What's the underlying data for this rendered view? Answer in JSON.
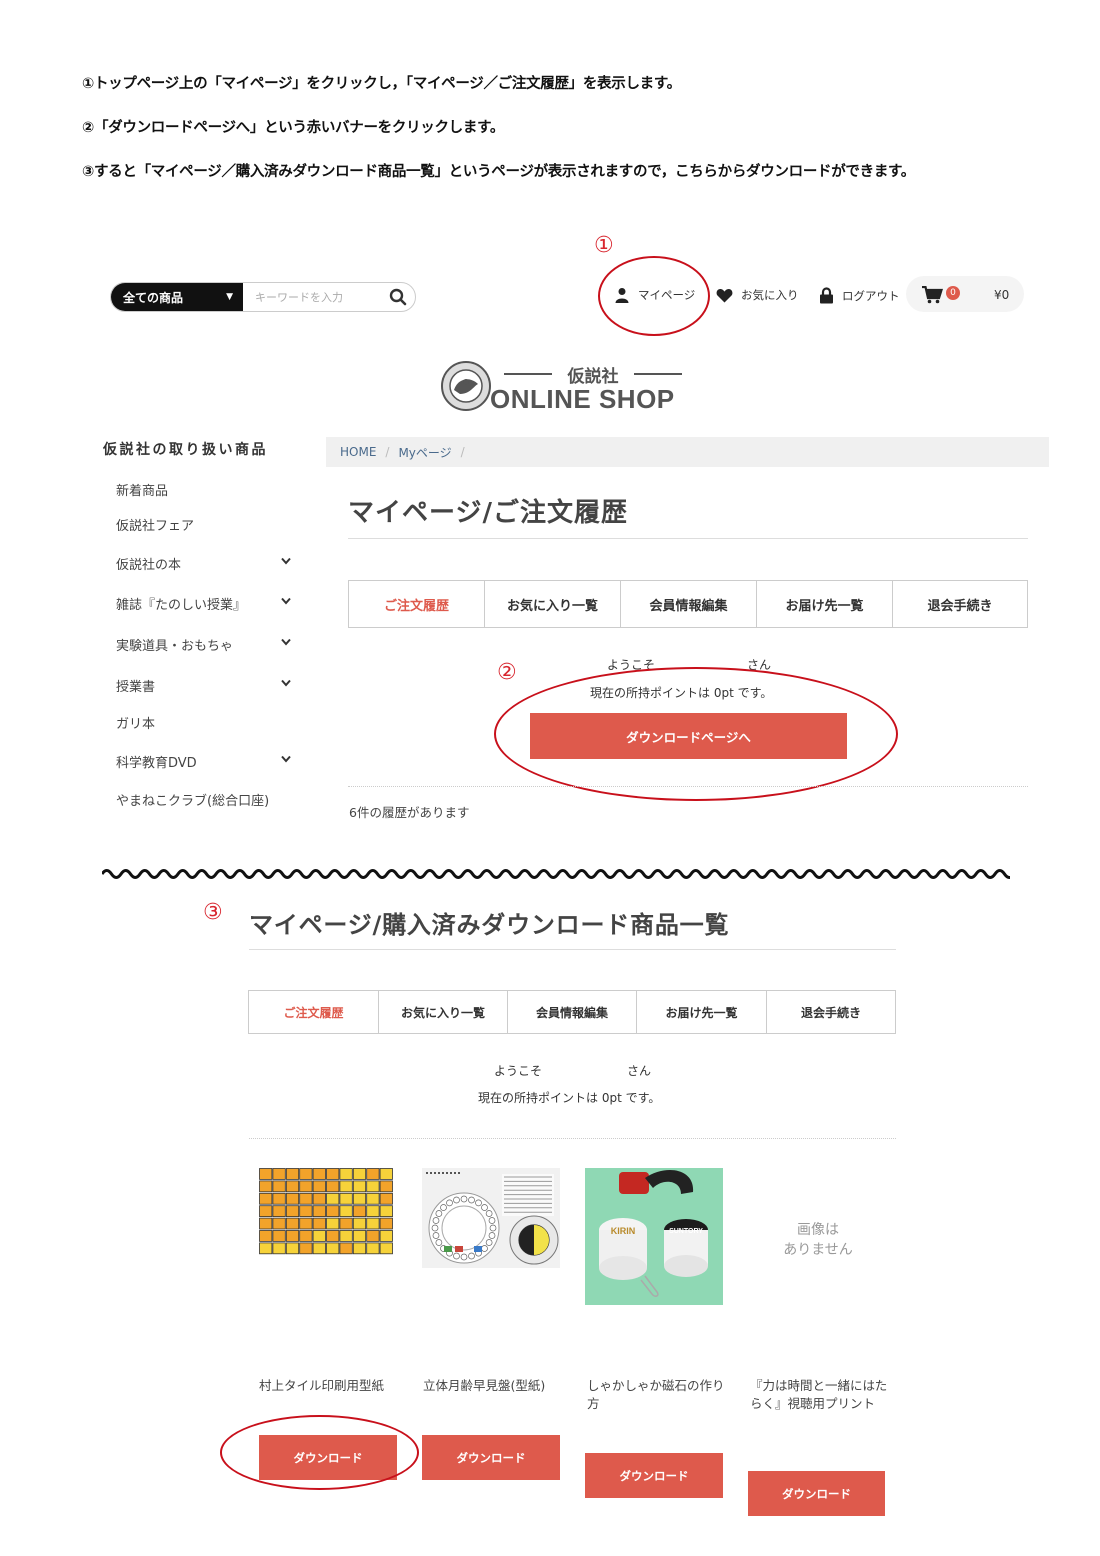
{
  "instructions": [
    "①トップページ上の「マイページ」をクリックし，「マイページ／ご注文履歴」を表示します。",
    "②「ダウンロードページへ」という赤いバナーをクリックします。",
    "③すると「マイページ／購入済みダウンロード商品一覧」というページが表示されますので，こちらからダウンロードができます。"
  ],
  "markers": {
    "one": "①",
    "two": "②",
    "three": "③"
  },
  "header": {
    "category_select": "全ての商品",
    "search_placeholder": "キーワードを入力",
    "mypage": "マイページ",
    "favorites": "お気に入り",
    "logout": "ログアウト",
    "cart_count": "0",
    "cart_total": "¥0"
  },
  "logo": {
    "subtitle": "仮説社",
    "title": "ONLINE SHOP"
  },
  "sidebar": {
    "title": "仮説社の取り扱い商品",
    "items": [
      {
        "label": "新着商品",
        "expandable": false
      },
      {
        "label": "仮説社フェア",
        "expandable": false
      },
      {
        "label": "仮説社の本",
        "expandable": true
      },
      {
        "label": "雑誌『たのしい授業』",
        "expandable": true
      },
      {
        "label": "実験道具・おもちゃ",
        "expandable": true
      },
      {
        "label": "授業書",
        "expandable": true
      },
      {
        "label": "ガリ本",
        "expandable": false
      },
      {
        "label": "科学教育DVD",
        "expandable": true
      },
      {
        "label": "やまねこクラブ(総合口座)",
        "expandable": false
      }
    ]
  },
  "breadcrumb": {
    "home": "HOME",
    "mypage": "Myページ",
    "sep": "/"
  },
  "order_history": {
    "title": "マイページ/ご注文履歴",
    "tabs": [
      "ご注文履歴",
      "お気に入り一覧",
      "会員情報編集",
      "お届け先一覧",
      "退会手続き"
    ],
    "welcome_prefix": "ようこそ",
    "welcome_suffix": "さん",
    "points": "現在の所持ポイントは 0pt です。",
    "download_banner": "ダウンロードページへ",
    "history_count": "6件の履歴があります"
  },
  "downloads": {
    "title": "マイページ/購入済みダウンロード商品一覧",
    "tabs": [
      "ご注文履歴",
      "お気に入り一覧",
      "会員情報編集",
      "お届け先一覧",
      "退会手続き"
    ],
    "welcome_prefix": "ようこそ",
    "welcome_suffix": "さん",
    "points": "現在の所持ポイントは 0pt です。",
    "no_image": "画像は\nありません",
    "products": [
      {
        "name": "村上タイル印刷用型紙",
        "button": "ダウンロード"
      },
      {
        "name": "立体月齢早見盤(型紙)",
        "button": "ダウンロード"
      },
      {
        "name": "しゃかしゃか磁石の作り方",
        "button": "ダウンロード"
      },
      {
        "name": "『力は時間と一緒にはたらく』視聴用プリント",
        "button": "ダウンロード"
      }
    ],
    "thumb_text": {
      "kirin": "KIRIN",
      "suntory": "SUNTORY"
    }
  },
  "colors": {
    "accent": "#de5a4c",
    "annotation": "#c8101b"
  }
}
